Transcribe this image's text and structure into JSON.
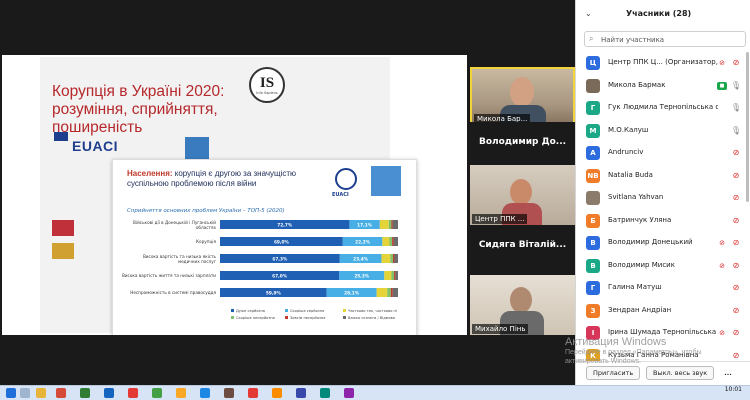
{
  "slide": {
    "title": "Корупція в Україні 2020: розуміння, сприйняття, поширеність",
    "is_logo_text": "IS",
    "is_logo_sub": "Info Sapiens",
    "euaci_text": "EUACI",
    "card": {
      "heading_highlight": "Населення:",
      "heading_rest": " корупція є другою за значущістю суспільною проблемою після війни",
      "euaci_text": "EUACI"
    }
  },
  "chart_data": {
    "type": "bar",
    "orientation": "horizontal",
    "stacked": true,
    "title": "Сприйняття основних проблем України – ТОП-5 (2020)",
    "categories": [
      "Військові дії в Донецькій і Луганській областях",
      "Корупція",
      "Висока вартість та низька якість медичних послуг",
      "Висока вартість життя та низькі зарплати",
      "Неспроможність в системі правосуддя"
    ],
    "series": [
      {
        "name": "Дуже серйозна",
        "values": [
          72.7,
          69.0,
          67.3,
          67.0,
          59.9
        ],
        "color": "#1f5fb4"
      },
      {
        "name": "Скоріше серйозна",
        "values": [
          17.1,
          22.2,
          23.4,
          25.3,
          28.1
        ],
        "color": "#47aee6"
      },
      {
        "name": "Частково так, частково ні",
        "values": [
          5.0,
          4.0,
          5.0,
          4.0,
          6.0
        ],
        "color": "#e4d43a"
      },
      {
        "name": "Скоріше несерйозна",
        "values": [
          1.5,
          1.5,
          1.5,
          1.5,
          2.0
        ],
        "color": "#7fc26a"
      },
      {
        "name": "Зовсім несерйозна",
        "values": [
          0.7,
          0.8,
          0.8,
          0.7,
          1.0
        ],
        "color": "#c0392b"
      },
      {
        "name": "Важко сказати / Відмова",
        "values": [
          3.0,
          2.5,
          2.0,
          1.5,
          3.0
        ],
        "color": "#6b6b6b"
      }
    ],
    "value_labels": [
      [
        "72,7%",
        "17,1%"
      ],
      [
        "69,0%",
        "22,2%"
      ],
      [
        "67,3%",
        "23,4%"
      ],
      [
        "67,0%",
        "25,3%"
      ],
      [
        "59,9%",
        "28,1%"
      ]
    ],
    "xlim": [
      0,
      100
    ],
    "legend_position": "bottom"
  },
  "thumbnails": [
    {
      "name": "Микола Бар...",
      "style": "video"
    },
    {
      "name": "Володимир До...",
      "style": "name"
    },
    {
      "name": "Центр ППК ...",
      "style": "video"
    },
    {
      "name": "Сидяга Віталій...",
      "style": "name"
    },
    {
      "name": "Михайло Пінь",
      "style": "video"
    }
  ],
  "panel": {
    "title": "Учасники (28)",
    "search_placeholder": "Найти участника",
    "participants": [
      {
        "initial": "Ц",
        "color": "#2d6cdf",
        "name": "Центр ППК Ц... (Организатор, я)",
        "mic": "off",
        "cam": "off"
      },
      {
        "initial": "",
        "color": "#7a6a5a",
        "name": "Микола Бармак",
        "mic": "on",
        "cam": "green"
      },
      {
        "initial": "Г",
        "color": "#1aa886",
        "name": "Гук Людмила Тернопільська обласн...",
        "mic": "on",
        "cam": "none"
      },
      {
        "initial": "М",
        "color": "#1aa886",
        "name": "М.О.Калуш",
        "mic": "on",
        "cam": "none"
      },
      {
        "initial": "А",
        "color": "#2d6cdf",
        "name": "Andrunciv",
        "mic": "off",
        "cam": "none"
      },
      {
        "initial": "NB",
        "color": "#f07c2a",
        "name": "Natalia Buda",
        "mic": "off",
        "cam": "none"
      },
      {
        "initial": "",
        "color": "#8a7b6a",
        "name": "Svitlana Yahvan",
        "mic": "off",
        "cam": "none"
      },
      {
        "initial": "Б",
        "color": "#f07c2a",
        "name": "Батринчук Уляна",
        "mic": "off",
        "cam": "none"
      },
      {
        "initial": "В",
        "color": "#2d6cdf",
        "name": "Володимир Донецький",
        "mic": "off",
        "cam": "off"
      },
      {
        "initial": "В",
        "color": "#1aa886",
        "name": "Володимир Мисик",
        "mic": "off",
        "cam": "off"
      },
      {
        "initial": "Г",
        "color": "#2d6cdf",
        "name": "Галина Матуш",
        "mic": "off",
        "cam": "none"
      },
      {
        "initial": "З",
        "color": "#f07c2a",
        "name": "Зендран Андріан",
        "mic": "off",
        "cam": "none"
      },
      {
        "initial": "І",
        "color": "#d7365a",
        "name": "Ірина Шумада Тернопільська ...",
        "mic": "off",
        "cam": "off"
      },
      {
        "initial": "К",
        "color": "#e0a020",
        "name": "Кузьма Ганна Романівна",
        "mic": "off",
        "cam": "none"
      }
    ],
    "invite_label": "Пригласить",
    "muteall_label": "Выкл. весь звук",
    "more_label": "..."
  },
  "watermark": {
    "line1": "Активация Windows",
    "line2": "Перейдите в раздел «Параметры», чтобы активировать Windows."
  },
  "taskbar": {
    "time": "10:01"
  }
}
